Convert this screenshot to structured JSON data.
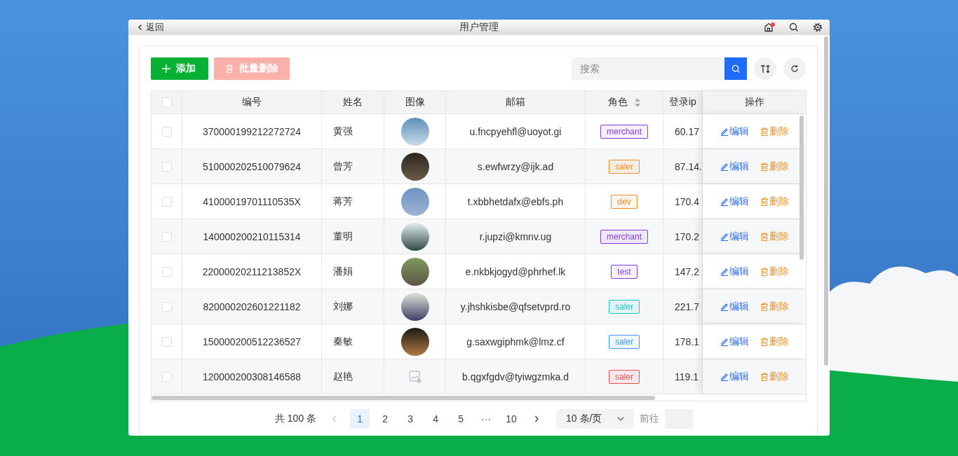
{
  "window": {
    "back_label": "返回",
    "title": "用户管理",
    "home_badge": true
  },
  "toolbar": {
    "add_label": "添加",
    "batch_delete": {
      "label": "批量删除",
      "disabled": true
    },
    "search": {
      "placeholder": "搜索"
    }
  },
  "table": {
    "columns": [
      {
        "label": "编号"
      },
      {
        "label": "姓名"
      },
      {
        "label": "图像"
      },
      {
        "label": "邮箱"
      },
      {
        "label": "角色",
        "sortable": true
      },
      {
        "label": "登录ip"
      },
      {
        "label": "操作"
      }
    ],
    "header_checked": false,
    "rows": [
      {
        "checked": false,
        "id": "370000199212272724",
        "name": "黄强",
        "avatar": {
          "kind": "photo"
        },
        "email": "u.fncpyehfl@uoyot.gi",
        "role": "merchant",
        "color": "#8a3ee0",
        "ip": "60.17",
        "edit": "编辑",
        "delete": "删除"
      },
      {
        "checked": false,
        "id": "510000202510079624",
        "name": "曾芳",
        "avatar": {
          "kind": "photo"
        },
        "email": "s.ewfwrzy@ijk.ad",
        "role": "saler",
        "color": "#f58a1f",
        "ip": "87.14.",
        "edit": "编辑",
        "delete": "删除"
      },
      {
        "checked": false,
        "id": "41000019701110535X",
        "name": "蒋芳",
        "avatar": {
          "kind": "photo"
        },
        "email": "t.xbbhetdafx@ebfs.ph",
        "role": "dev",
        "color": "#f58a1f",
        "ip": "170.4",
        "edit": "编辑",
        "delete": "删除"
      },
      {
        "checked": false,
        "id": "140000200210115314",
        "name": "董明",
        "avatar": {
          "kind": "photo"
        },
        "email": "r.jupzi@kmnv.ug",
        "role": "merchant",
        "color": "#8a3ee0",
        "ip": "170.2",
        "edit": "编辑",
        "delete": "删除"
      },
      {
        "checked": false,
        "id": "22000020211213852X",
        "name": "潘娟",
        "avatar": {
          "kind": "photo"
        },
        "email": "e.nkbkjogyd@phrhef.lk",
        "role": "test",
        "color": "#8a3ee0",
        "ip": "147.2",
        "edit": "编辑",
        "delete": "删除"
      },
      {
        "checked": false,
        "id": "820000202601221182",
        "name": "刘娜",
        "avatar": {
          "kind": "photo"
        },
        "email": "y.jhshkisbe@qfsetvprd.ro",
        "role": "saler",
        "color": "#17c9c0",
        "ip": "221.7",
        "edit": "编辑",
        "delete": "删除"
      },
      {
        "checked": false,
        "id": "150000200512236527",
        "name": "秦敏",
        "avatar": {
          "kind": "photo"
        },
        "email": "g.saxwgiphmk@lmz.cf",
        "role": "saler",
        "color": "#3a98f5",
        "ip": "178.1",
        "edit": "编辑",
        "delete": "删除"
      },
      {
        "checked": false,
        "id": "120000200308146588",
        "name": "赵艳",
        "avatar": {
          "kind": "missing"
        },
        "email": "b.qgxfgdv@tyiwgzmka.d",
        "role": "saler",
        "color": "#ef4f4f",
        "ip": "119.1",
        "edit": "编辑",
        "delete": "删除"
      }
    ]
  },
  "pagination": {
    "total": "共 100 条",
    "prev_disabled": true,
    "pages": [
      {
        "label": "1",
        "selected": true
      },
      {
        "label": "2",
        "selected": false
      },
      {
        "label": "3",
        "selected": false
      },
      {
        "label": "4",
        "selected": false
      },
      {
        "label": "5",
        "selected": false
      },
      {
        "label": "···",
        "selected": false
      },
      {
        "label": "10",
        "selected": false
      }
    ],
    "page_size": "10 条/页",
    "goto_label": "前往"
  }
}
